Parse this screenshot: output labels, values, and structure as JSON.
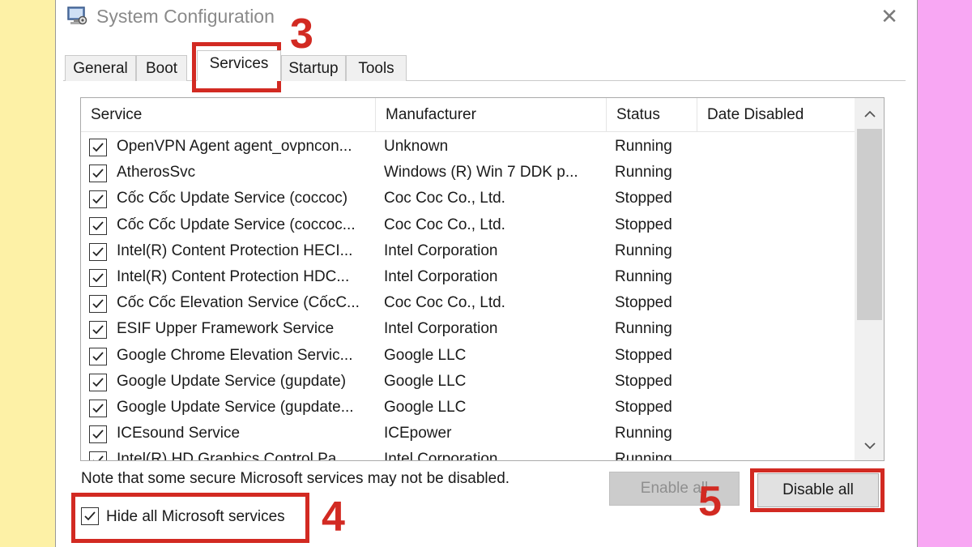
{
  "window": {
    "title": "System Configuration",
    "close_symbol": "✕",
    "icon": "system-configuration-icon"
  },
  "tabs": [
    {
      "label": "General",
      "active": false
    },
    {
      "label": "Boot",
      "active": false
    },
    {
      "label": "Services",
      "active": true
    },
    {
      "label": "Startup",
      "active": false
    },
    {
      "label": "Tools",
      "active": false
    }
  ],
  "list": {
    "columns": [
      "Service",
      "Manufacturer",
      "Status",
      "Date Disabled"
    ],
    "rows": [
      {
        "checked": true,
        "service": "OpenVPN Agent agent_ovpncon...",
        "manufacturer": "Unknown",
        "status": "Running",
        "date_disabled": ""
      },
      {
        "checked": true,
        "service": "AtherosSvc",
        "manufacturer": "Windows (R) Win 7 DDK p...",
        "status": "Running",
        "date_disabled": ""
      },
      {
        "checked": true,
        "service": "Cốc Cốc Update Service (coccoc)",
        "manufacturer": "Coc Coc Co., Ltd.",
        "status": "Stopped",
        "date_disabled": ""
      },
      {
        "checked": true,
        "service": "Cốc Cốc Update Service (coccoc...",
        "manufacturer": "Coc Coc Co., Ltd.",
        "status": "Stopped",
        "date_disabled": ""
      },
      {
        "checked": true,
        "service": "Intel(R) Content Protection HECI...",
        "manufacturer": "Intel Corporation",
        "status": "Running",
        "date_disabled": ""
      },
      {
        "checked": true,
        "service": "Intel(R) Content Protection HDC...",
        "manufacturer": "Intel Corporation",
        "status": "Running",
        "date_disabled": ""
      },
      {
        "checked": true,
        "service": "Cốc Cốc Elevation Service (CốcC...",
        "manufacturer": "Coc Coc Co., Ltd.",
        "status": "Stopped",
        "date_disabled": ""
      },
      {
        "checked": true,
        "service": "ESIF Upper Framework Service",
        "manufacturer": "Intel Corporation",
        "status": "Running",
        "date_disabled": ""
      },
      {
        "checked": true,
        "service": "Google Chrome Elevation Servic...",
        "manufacturer": "Google LLC",
        "status": "Stopped",
        "date_disabled": ""
      },
      {
        "checked": true,
        "service": "Google Update Service (gupdate)",
        "manufacturer": "Google LLC",
        "status": "Stopped",
        "date_disabled": ""
      },
      {
        "checked": true,
        "service": "Google Update Service (gupdate...",
        "manufacturer": "Google LLC",
        "status": "Stopped",
        "date_disabled": ""
      },
      {
        "checked": true,
        "service": "ICEsound Service",
        "manufacturer": "ICEpower",
        "status": "Running",
        "date_disabled": ""
      },
      {
        "checked": true,
        "service": "Intel(R) HD Graphics Control Pa...",
        "manufacturer": "Intel Corporation",
        "status": "Running",
        "date_disabled": ""
      }
    ],
    "scroll_up": "⌃",
    "scroll_down": "⌄"
  },
  "footer": {
    "note": "Note that some secure Microsoft services may not be disabled.",
    "hide_ms_label": "Hide all Microsoft services",
    "hide_ms_checked": true,
    "enable_all_label": "Enable all",
    "enable_all_disabled": true,
    "disable_all_label": "Disable all"
  },
  "annotations": [
    "3",
    "4",
    "5"
  ],
  "colors": {
    "annotation_red": "#d22a22",
    "left_background": "#fdf1a6",
    "right_background": "#f8a7f3"
  }
}
